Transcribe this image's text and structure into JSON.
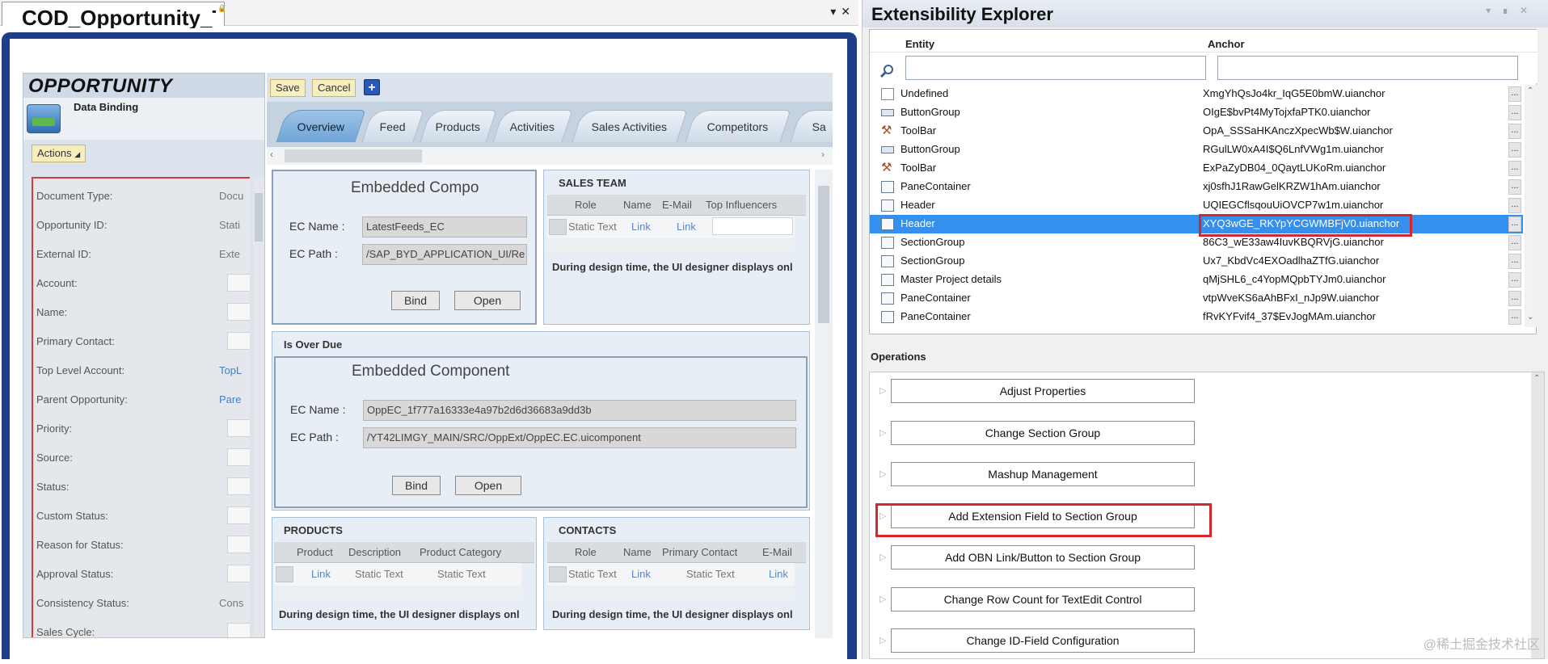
{
  "doc_tab": {
    "title": "COD_Opportunity_TI"
  },
  "opportunity": {
    "title": "OPPORTUNITY",
    "subtitle": "Data Binding",
    "actions_label": "Actions",
    "fields": [
      {
        "label": "Document Type:",
        "value": "Docu",
        "kind": "text"
      },
      {
        "label": "Opportunity ID:",
        "value": "Stati",
        "kind": "text"
      },
      {
        "label": "External ID:",
        "value": "Exte",
        "kind": "text"
      },
      {
        "label": "Account:",
        "value": "",
        "kind": "box"
      },
      {
        "label": "Name:",
        "value": "",
        "kind": "box"
      },
      {
        "label": "Primary Contact:",
        "value": "",
        "kind": "box"
      },
      {
        "label": "Top Level Account:",
        "value": "TopL",
        "kind": "link"
      },
      {
        "label": "Parent Opportunity:",
        "value": "Pare",
        "kind": "link"
      },
      {
        "label": "Priority:",
        "value": "",
        "kind": "box"
      },
      {
        "label": "Source:",
        "value": "",
        "kind": "box"
      },
      {
        "label": "Status:",
        "value": "",
        "kind": "box"
      },
      {
        "label": "Custom Status:",
        "value": "",
        "kind": "box"
      },
      {
        "label": "Reason for Status:",
        "value": "",
        "kind": "box"
      },
      {
        "label": "Approval Status:",
        "value": "",
        "kind": "box"
      },
      {
        "label": "Consistency Status:",
        "value": "Cons",
        "kind": "text"
      },
      {
        "label": "Sales Cycle:",
        "value": "",
        "kind": "box"
      }
    ]
  },
  "toolbar": {
    "save": "Save",
    "cancel": "Cancel",
    "plus": "+"
  },
  "tabs": [
    "Overview",
    "Feed",
    "Products",
    "Activities",
    "Sales Activities",
    "Competitors",
    "Sa"
  ],
  "embedded1": {
    "title": "Embedded Compo",
    "name_label": "EC Name :",
    "name_value": "LatestFeeds_EC",
    "path_label": "EC Path :",
    "path_value": "/SAP_BYD_APPLICATION_UI/Re",
    "bind": "Bind",
    "open": "Open"
  },
  "sales_team": {
    "title": "SALES TEAM",
    "headers": [
      "Role",
      "Name",
      "E-Mail",
      "Top Influencers"
    ],
    "row": [
      "Static Text",
      "Link",
      "Link",
      ""
    ],
    "note": "During design time, the UI designer displays onl"
  },
  "overdue": {
    "title": "Is Over Due",
    "ec_title": "Embedded Component",
    "name_label": "EC Name :",
    "name_value": "OppEC_1f777a16333e4a97b2d6d36683a9dd3b",
    "path_label": "EC Path :",
    "path_value": "/YT42LIMGY_MAIN/SRC/OppExt/OppEC.EC.uicomponent",
    "bind": "Bind",
    "open": "Open"
  },
  "products": {
    "title": "PRODUCTS",
    "headers": [
      "Product",
      "Description",
      "Product Category"
    ],
    "row": [
      "Link",
      "Static Text",
      "Static Text"
    ],
    "note": "During design time, the UI designer displays onl"
  },
  "contacts": {
    "title": "CONTACTS",
    "headers": [
      "Role",
      "Name",
      "Primary Contact",
      "E-Mail"
    ],
    "row": [
      "Static Text",
      "Link",
      "Static Text",
      "Link"
    ],
    "note": "During design time, the UI designer displays onl"
  },
  "explorer": {
    "title": "Extensibility Explorer",
    "col_entity": "Entity",
    "col_anchor": "Anchor",
    "rows": [
      {
        "entity": "Undefined",
        "anchor": "XmgYhQsJo4kr_IqG5E0bmW.uianchor",
        "icon": "doc"
      },
      {
        "entity": "ButtonGroup",
        "anchor": "OIgE$bvPt4MyTojxfaPTK0.uianchor",
        "icon": "btn"
      },
      {
        "entity": "ToolBar",
        "anchor": "OpA_SSSaHKAnczXpecWb$W.uianchor",
        "icon": "tool"
      },
      {
        "entity": "ButtonGroup",
        "anchor": "RGulLW0xA4I$Q6LnfVWg1m.uianchor",
        "icon": "btn"
      },
      {
        "entity": "ToolBar",
        "anchor": "ExPaZyDB04_0QaytLUKoRm.uianchor",
        "icon": "tool"
      },
      {
        "entity": "PaneContainer",
        "anchor": "xj0sfhJ1RawGelKRZW1hAm.uianchor",
        "icon": "pane"
      },
      {
        "entity": "Header",
        "anchor": "UQIEGCflsqouUiOVCP7w1m.uianchor",
        "icon": "pane"
      },
      {
        "entity": "Header",
        "anchor": "XYQ3wGE_RKYpYCGWMBFjV0.uianchor",
        "icon": "pane",
        "selected": true
      },
      {
        "entity": "SectionGroup",
        "anchor": "86C3_wE33aw4IuvKBQRVjG.uianchor",
        "icon": "pane"
      },
      {
        "entity": "SectionGroup",
        "anchor": "Ux7_KbdVc4EXOadlhaZTfG.uianchor",
        "icon": "pane"
      },
      {
        "entity": "Master Project details",
        "anchor": "qMjSHL6_c4YopMQpbTYJm0.uianchor",
        "icon": "pane"
      },
      {
        "entity": "PaneContainer",
        "anchor": "vtpWveKS6aAhBFxI_nJp9W.uianchor",
        "icon": "pane"
      },
      {
        "entity": "PaneContainer",
        "anchor": "fRvKYFvif4_37$EvJogMAm.uianchor",
        "icon": "pane"
      }
    ],
    "dots": "...",
    "operations_label": "Operations",
    "operations": [
      "Adjust Properties",
      "Change Section Group",
      "Mashup Management",
      "Add Extension Field to Section Group",
      "Add OBN Link/Button to Section Group",
      "Change Row Count for TextEdit Control",
      "Change ID-Field Configuration"
    ]
  },
  "watermark": "@稀土掘金技术社区",
  "colors": {
    "frame": "#1d3f8a",
    "selection": "#3390ee",
    "highlight": "#d6262e",
    "action_button": "#f7eec0"
  }
}
